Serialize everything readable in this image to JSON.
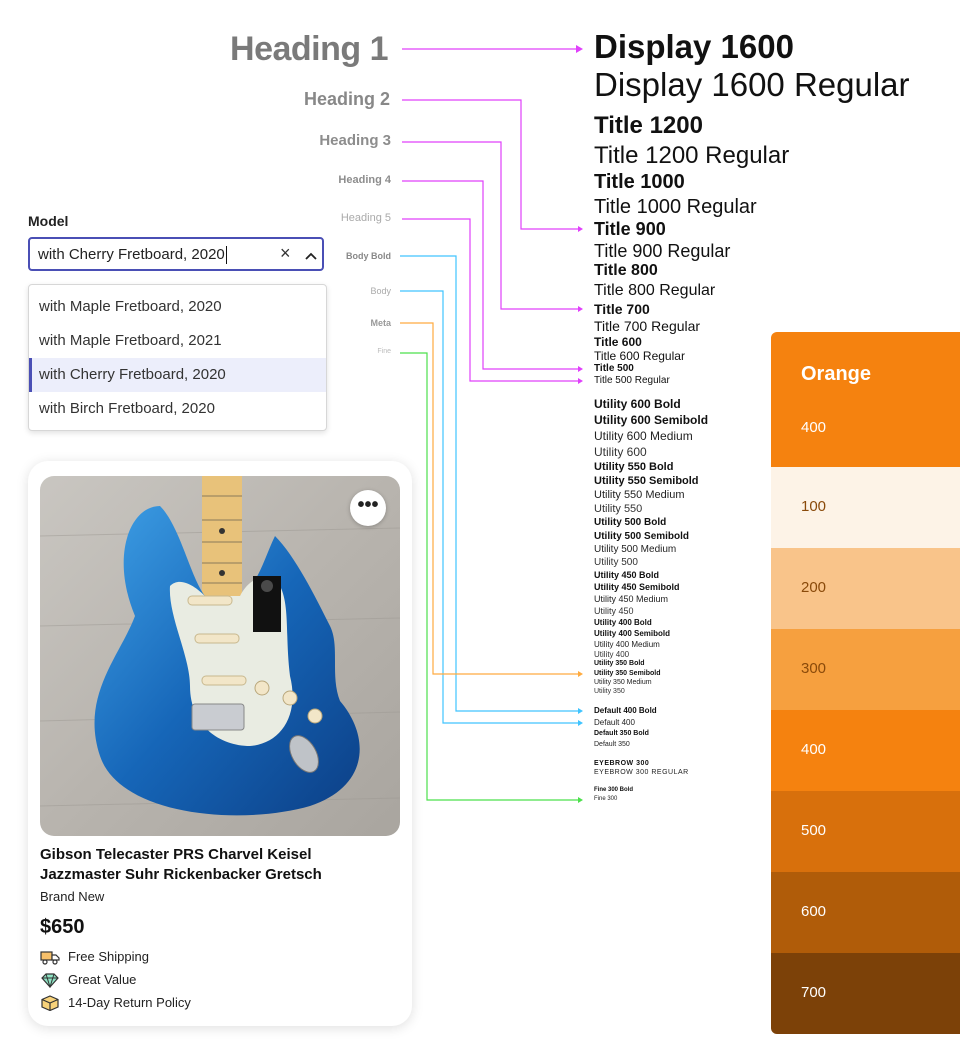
{
  "headings": {
    "h1": "Heading 1",
    "h2": "Heading 2",
    "h3": "Heading 3",
    "h4": "Heading 4",
    "h5": "Heading 5",
    "body_bold": "Body Bold",
    "body": "Body",
    "meta": "Meta",
    "fine": "Fine"
  },
  "specimens": [
    "Display 1600",
    "Display 1600 Regular",
    "Title 1200",
    "Title 1200 Regular",
    "Title 1000",
    "Title 1000 Regular",
    "Title 900",
    "Title 900 Regular",
    "Title 800",
    "Title 800 Regular",
    "Title 700",
    "Title 700 Regular",
    "Title 600",
    "Title 600 Regular",
    "Title 500",
    "Title 500 Regular",
    "Utility 600 Bold",
    "Utility 600 Semibold",
    "Utility 600 Medium",
    "Utility 600",
    "Utility 550 Bold",
    "Utility 550 Semibold",
    "Utility 550 Medium",
    "Utility 550",
    "Utility 500 Bold",
    "Utility 500 Semibold",
    "Utility 500 Medium",
    "Utility 500",
    "Utility 450 Bold",
    "Utility 450 Semibold",
    "Utility 450 Medium",
    "Utility 450",
    "Utility 400 Bold",
    "Utility 400 Semibold",
    "Utility 400 Medium",
    "Utility 400",
    "Utility 350 Bold",
    "Utility 350 Semibold",
    "Utility 350 Medium",
    "Utility 350",
    "Default 400 Bold",
    "Default 400",
    "Default 350 Bold",
    "Default 350",
    "EYEBROW 300",
    "EYEBROW 300 REGULAR",
    "Fine 300 Bold",
    "Fine 300"
  ],
  "connector_colors": {
    "heading": "#e040fb",
    "body": "#40c4ff",
    "meta": "#ffab40",
    "fine": "#4ce04c"
  },
  "model_field": {
    "label": "Model",
    "value": "with Cherry Fretboard, 2020",
    "clear_icon": "close-icon",
    "toggle_icon": "chevron-up-icon"
  },
  "dropdown": {
    "options": [
      "with Maple Fretboard, 2020",
      "with Maple Fretboard, 2021",
      "with Cherry Fretboard, 2020",
      "with Birch Fretboard, 2020"
    ],
    "selected_index": 2
  },
  "product": {
    "title": "Gibson Telecaster PRS Charvel Keisel Jazzmaster Suhr Rickenbacker Gretsch",
    "condition": "Brand New",
    "price": "$650",
    "features": [
      {
        "icon": "truck-icon",
        "label": "Free Shipping"
      },
      {
        "icon": "diamond-icon",
        "label": "Great Value"
      },
      {
        "icon": "box-icon",
        "label": "14-Day Return Policy"
      }
    ]
  },
  "palette": {
    "title": "Orange",
    "swatches": [
      {
        "label": "400",
        "color": "#f5820f"
      },
      {
        "label": "100",
        "color": "#fdf3e7"
      },
      {
        "label": "200",
        "color": "#f9c48a"
      },
      {
        "label": "300",
        "color": "#f6a03f"
      },
      {
        "label": "400",
        "color": "#f5820f"
      },
      {
        "label": "500",
        "color": "#d8700c"
      },
      {
        "label": "600",
        "color": "#b05c09"
      },
      {
        "label": "700",
        "color": "#7c4108"
      }
    ]
  }
}
